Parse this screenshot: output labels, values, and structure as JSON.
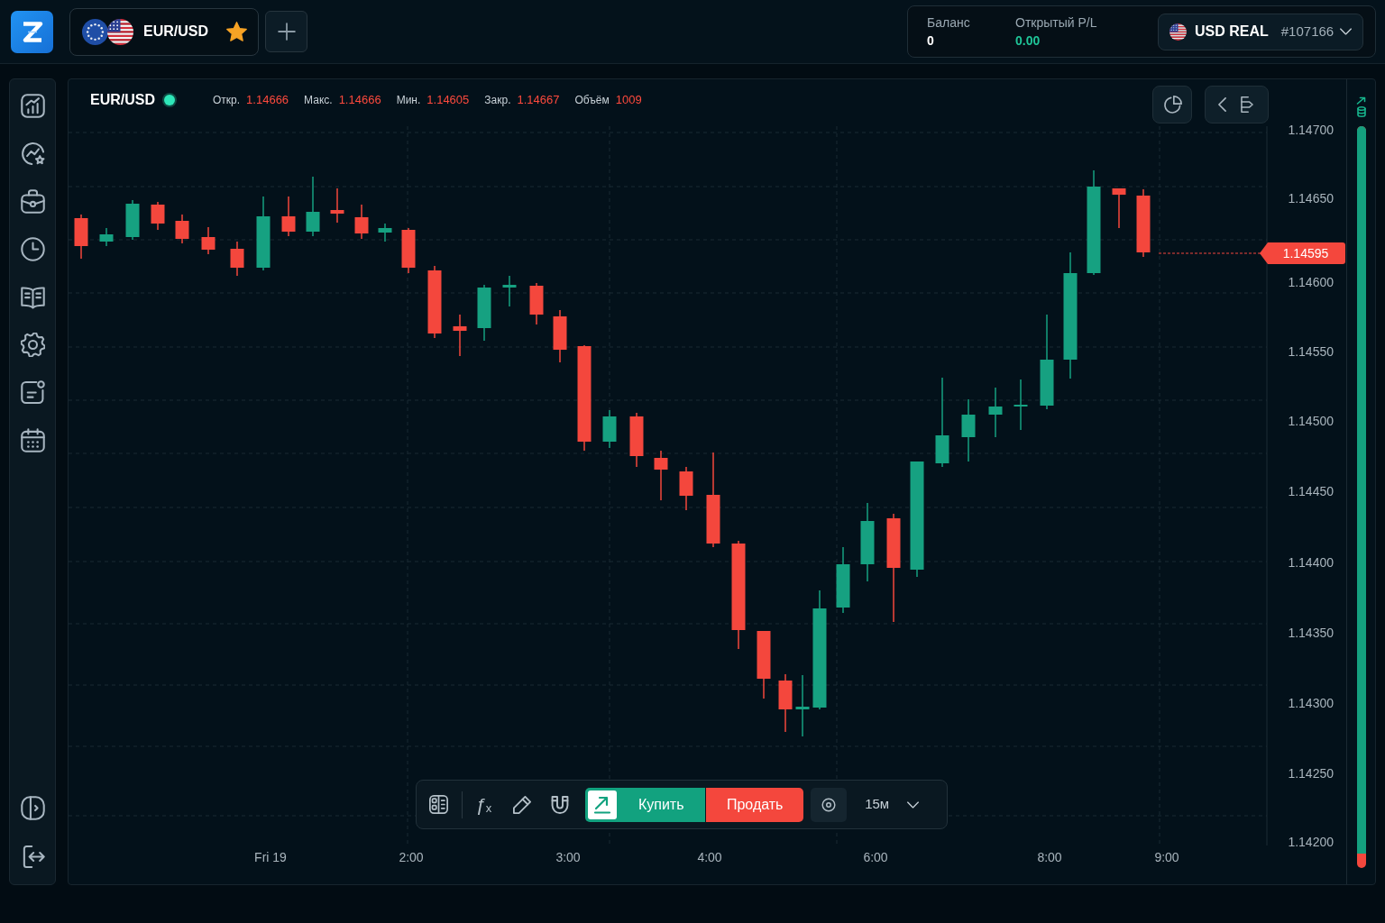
{
  "top_bar": {
    "instrument_tab": {
      "symbol": "EUR/USD",
      "favorite": true
    }
  },
  "account": {
    "balance_label": "Баланс",
    "balance": "0",
    "pl_label": "Открытый P/L",
    "pl": "0.00",
    "account_type": "USD REAL",
    "account_number": "#107166"
  },
  "chart": {
    "symbol": "EUR/USD",
    "live": true,
    "stats": [
      {
        "label": "Откр.",
        "value": "1.14666"
      },
      {
        "label": "Макс.",
        "value": "1.14666"
      },
      {
        "label": "Мин.",
        "value": "1.14605"
      },
      {
        "label": "Закр.",
        "value": "1.14667"
      },
      {
        "label": "Объём",
        "value": "1009"
      }
    ],
    "price_axis": {
      "labels": [
        "1.14700",
        "1.14650",
        "1.14600",
        "1.14550",
        "1.14500",
        "1.14450",
        "1.14400",
        "1.14350",
        "1.14300",
        "1.14250",
        "1.14200"
      ]
    },
    "current_price": "1.14595",
    "time_axis": {
      "labels": [
        "Fri 19",
        "2:00",
        "3:00",
        "4:00",
        "6:00",
        "8:00",
        "9:00"
      ]
    }
  },
  "sentiment_meter": {
    "level": 0.98
  },
  "toolbar": {
    "indicators": "ƒ$_{x}$",
    "buy": "Купить",
    "sell": "Продать",
    "timeframe": "15м"
  }
}
